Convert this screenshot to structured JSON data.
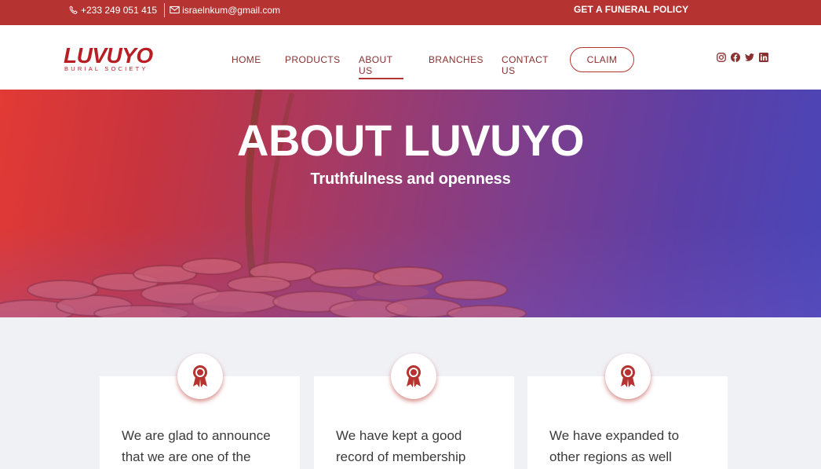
{
  "topbar": {
    "phone": "+233 249 051 415",
    "email": "israelnkum@gmail.com",
    "policy_link": "GET A FUNERAL POLICY"
  },
  "brand": {
    "name": "LUVUYO",
    "tagline": "BURIAL SOCIETY",
    "color": "#b71f24"
  },
  "nav": {
    "items": [
      {
        "label": "HOME",
        "active": false
      },
      {
        "label": "PRODUCTS",
        "active": false
      },
      {
        "label": "ABOUT US",
        "active": true
      },
      {
        "label": "BRANCHES",
        "active": false
      },
      {
        "label": "CONTACT US",
        "active": false
      }
    ],
    "claim_label": "CLAIM"
  },
  "social": [
    "instagram-icon",
    "facebook-icon",
    "twitter-icon",
    "linkedin-icon"
  ],
  "hero": {
    "title": "ABOUT LUVUYO",
    "subtitle": "Truthfulness and openness"
  },
  "cards": [
    {
      "icon": "award-ribbon-icon",
      "text": "We are glad to announce that we are one of the"
    },
    {
      "icon": "award-ribbon-icon",
      "text": "We have kept a good record of membership"
    },
    {
      "icon": "award-ribbon-icon",
      "text": "We have expanded to other regions as well"
    }
  ],
  "colors": {
    "accent": "#b53432",
    "nav_text": "#8a3030",
    "background": "#f0f1f5"
  }
}
